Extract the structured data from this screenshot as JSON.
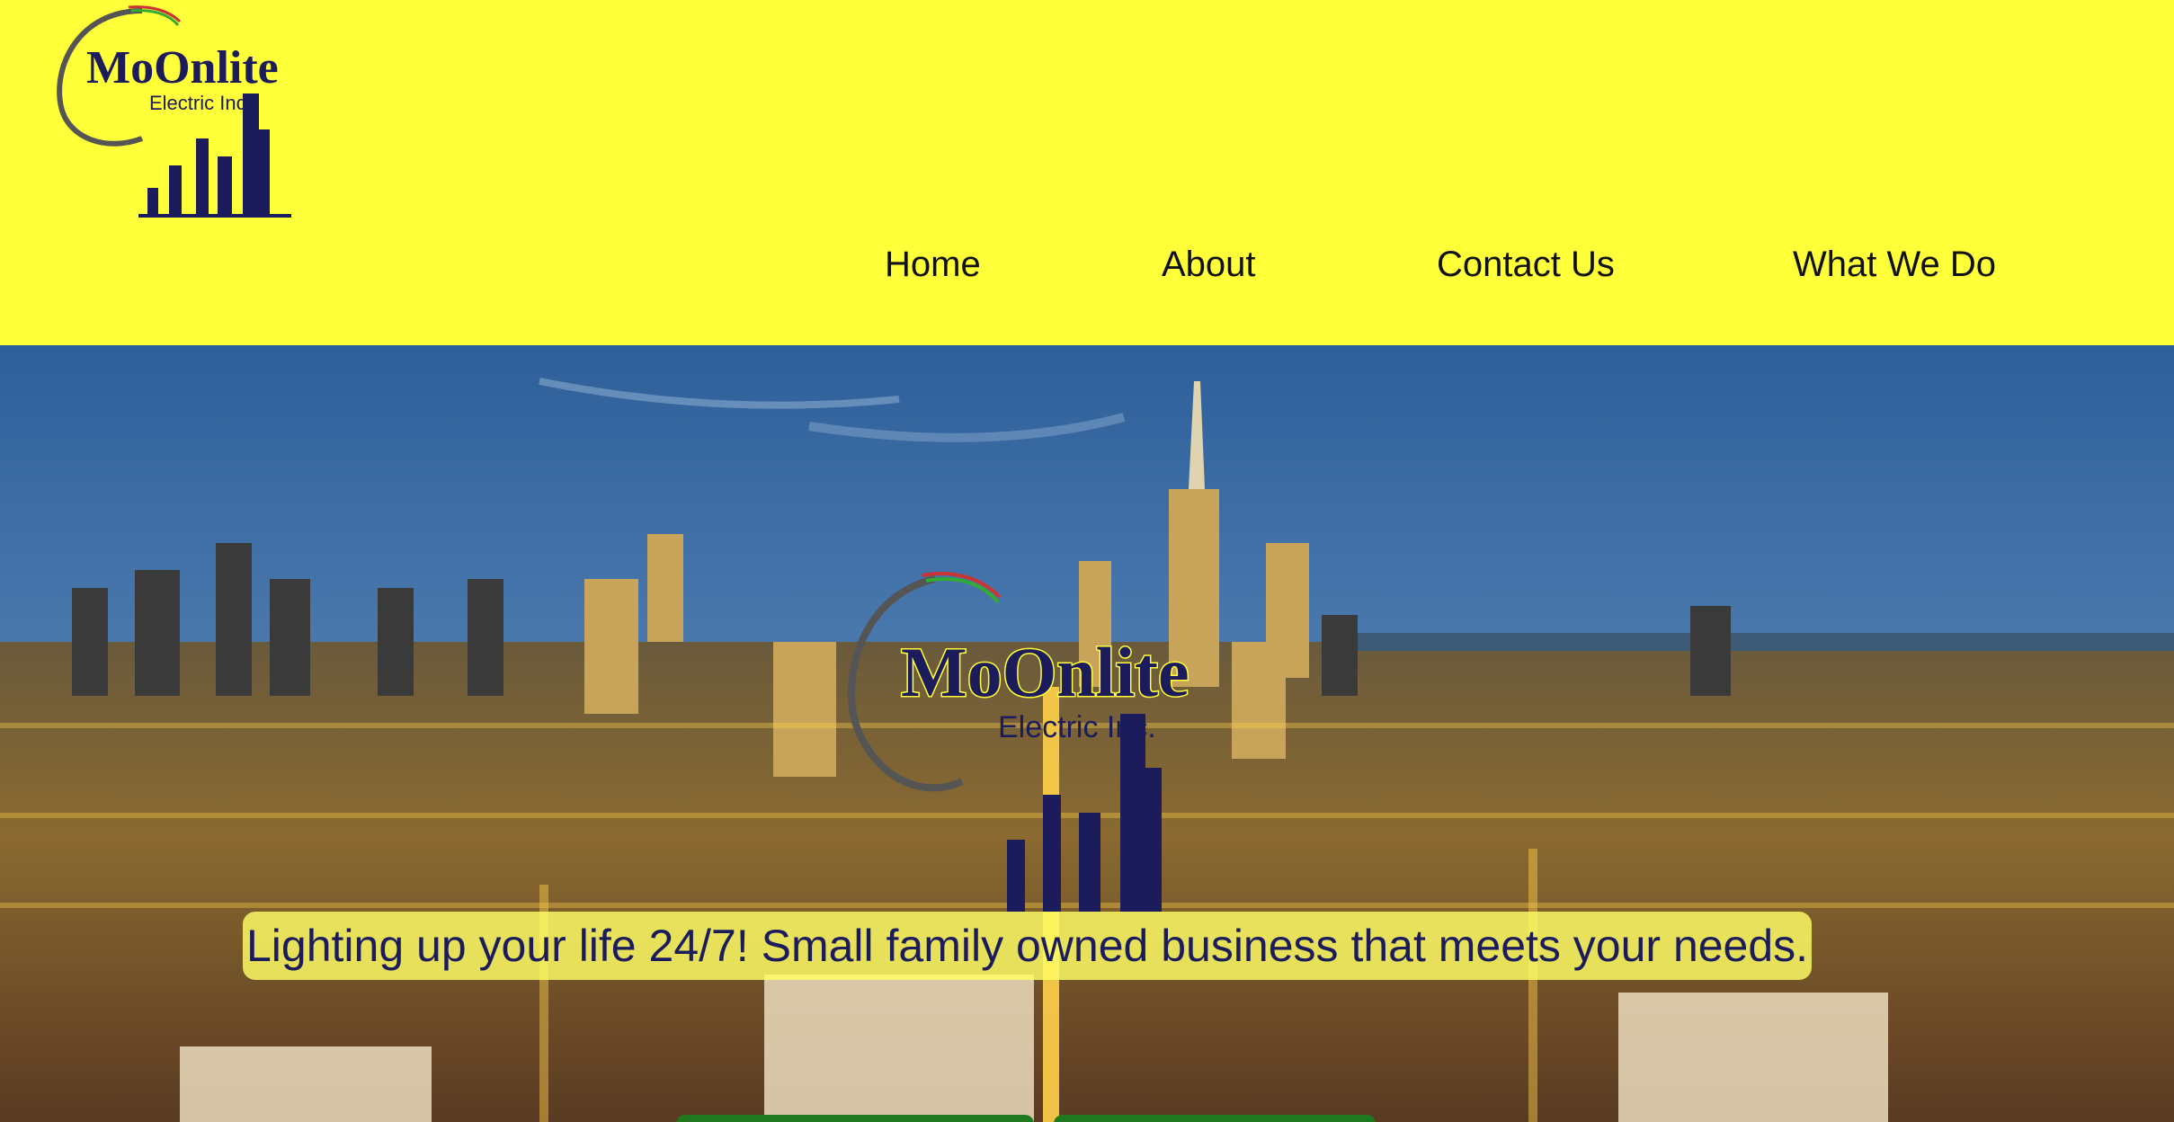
{
  "brand": {
    "name": "MoOnlite",
    "subtitle": "Electric Inc."
  },
  "nav": {
    "home": "Home",
    "about": "About",
    "contact": "Contact Us",
    "what_we_do": "What We Do"
  },
  "hero": {
    "tagline": "Lighting up your life 24/7! Small family owned business that meets your needs."
  },
  "colors": {
    "header_bg": "#ffff3a",
    "logo_navy": "#1c1c5c",
    "tagline_bg": "#ffff66",
    "cta_green": "#1f7a1f"
  },
  "icons": {
    "logo": "moonlite-logo",
    "background": "city-skyline-photo"
  }
}
